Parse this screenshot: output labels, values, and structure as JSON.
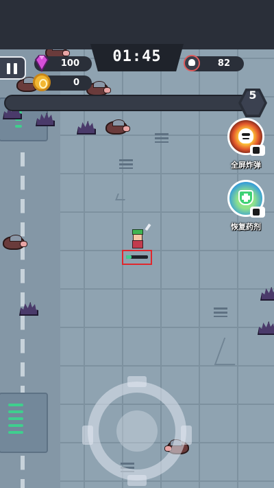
{
  "hud": {
    "timer": "01:45",
    "gems": "100",
    "coins": "0",
    "kills": "82",
    "level": "5",
    "xp_progress": 0.0
  },
  "skills": [
    {
      "label": "全屏炸弹",
      "icon": "skull-bomb-icon"
    },
    {
      "label": "恢复药剂",
      "icon": "health-potion-icon"
    }
  ],
  "player": {
    "hp_fraction": 0.25
  },
  "colors": {
    "floor": "#8fa3b1",
    "xp_track": "#353b47",
    "hp_fill": "#3fcf8e",
    "highlight": "#e0262c"
  }
}
